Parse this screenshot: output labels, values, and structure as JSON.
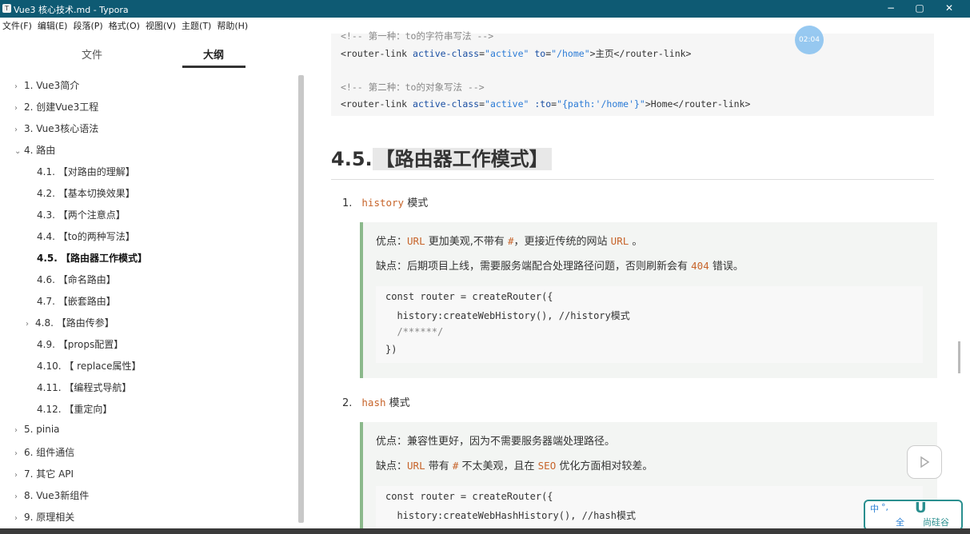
{
  "window": {
    "title": "Vue3 核心技术.md - Typora",
    "controls": [
      "−",
      "▢",
      "✕"
    ]
  },
  "menu": [
    "文件(F)",
    "编辑(E)",
    "段落(P)",
    "格式(O)",
    "视图(V)",
    "主题(T)",
    "帮助(H)"
  ],
  "sidebar": {
    "tabs": [
      "文件",
      "大纲"
    ],
    "outline": [
      {
        "label": "1. Vue3简介",
        "caret": "›",
        "level": 1
      },
      {
        "label": "2. 创建Vue3工程",
        "caret": "›",
        "level": 1
      },
      {
        "label": "3. Vue3核心语法",
        "caret": "›",
        "level": 1
      },
      {
        "label": "4. 路由",
        "caret": "⌄",
        "level": 1
      },
      {
        "label": "4.1. 【对路由的理解】",
        "caret": "",
        "level": 2
      },
      {
        "label": "4.2. 【基本切换效果】",
        "caret": "",
        "level": 2
      },
      {
        "label": "4.3. 【两个注意点】",
        "caret": "",
        "level": 2
      },
      {
        "label": "4.4. 【to的两种写法】",
        "caret": "",
        "level": 2
      },
      {
        "label": "4.5. 【路由器工作模式】",
        "caret": "",
        "level": 2,
        "active": true
      },
      {
        "label": "4.6. 【命名路由】",
        "caret": "",
        "level": 2
      },
      {
        "label": "4.7. 【嵌套路由】",
        "caret": "",
        "level": 2
      },
      {
        "label": "4.8. 【路由传参】",
        "caret": "›",
        "level": 2
      },
      {
        "label": "4.9. 【props配置】",
        "caret": "",
        "level": 2
      },
      {
        "label": "4.10. 【 replace属性】",
        "caret": "",
        "level": 2
      },
      {
        "label": "4.11. 【编程式导航】",
        "caret": "",
        "level": 2
      },
      {
        "label": "4.12. 【重定向】",
        "caret": "",
        "level": 2
      },
      {
        "label": "5. pinia",
        "caret": "›",
        "level": 1
      },
      {
        "label": "6. 组件通信",
        "caret": "›",
        "level": 1
      },
      {
        "label": "7. 其它 API",
        "caret": "›",
        "level": 1
      },
      {
        "label": "8. Vue3新组件",
        "caret": "›",
        "level": 1
      },
      {
        "label": "9. 原理相关",
        "caret": "›",
        "level": 1
      }
    ]
  },
  "top_code": {
    "comment1": "<!-- 第一种：to的字符串写法 -->",
    "line1_a": "<router-link ",
    "line1_attr1": "active-class",
    "line1_eq1": "=",
    "line1_val1": "\"active\"",
    "line1_attr2": " to",
    "line1_eq2": "=",
    "line1_val2": "\"/home\"",
    "line1_rest": ">主页</router-link>",
    "comment2": "<!-- 第二种：to的对象写法 -->",
    "line2_a": "<router-link ",
    "line2_attr1": "active-class",
    "line2_eq1": "=",
    "line2_val1": "\"active\"",
    "line2_attr2": " :to",
    "line2_eq2": "=",
    "line2_val2": "\"{path:'/home'}\"",
    "line2_rest": ">Home</router-link>"
  },
  "heading": {
    "prefix": "4.5.",
    "text": "【路由器工作模式】"
  },
  "item1": {
    "num": "1.",
    "code": "history",
    "text": " 模式",
    "pro_label": "优点：",
    "pro_code1": "URL",
    "pro_text1": " 更加美观,不带有 ",
    "pro_code2": "#",
    "pro_text2": "，更接近传统的网站 ",
    "pro_code3": "URL",
    "pro_text3": " 。",
    "con_label": "缺点：后期项目上线，需要服务端配合处理路径问题，否则刷新会有 ",
    "con_code": "404",
    "con_text": " 错误。",
    "code_lines": [
      "const router = createRouter({",
      "  history:createWebHistory(), //history模式",
      "  /******/",
      "})"
    ]
  },
  "item2": {
    "num": "2.",
    "code": "hash",
    "text": " 模式",
    "pro_label": "优点：兼容性更好，因为不需要服务器端处理路径。",
    "con_label": "缺点：",
    "con_code1": "URL",
    "con_text1": " 带有 ",
    "con_code2": "#",
    "con_text2": " 不太美观，且在 ",
    "con_code3": "SEO",
    "con_text3": " 优化方面相对较差。",
    "code_lines": [
      "const router = createRouter({",
      "  history:createWebHashHistory(), //hash模式"
    ]
  },
  "overlay": {
    "timer": "02:04",
    "ime_text1": "中",
    "ime_text2": "°,",
    "ime_text3": "全",
    "ime_brand": "尚硅谷"
  },
  "colors": {
    "titlebar": "#0e5a73",
    "quote_border": "#8bb98b",
    "inline_code": "#c7642a"
  }
}
